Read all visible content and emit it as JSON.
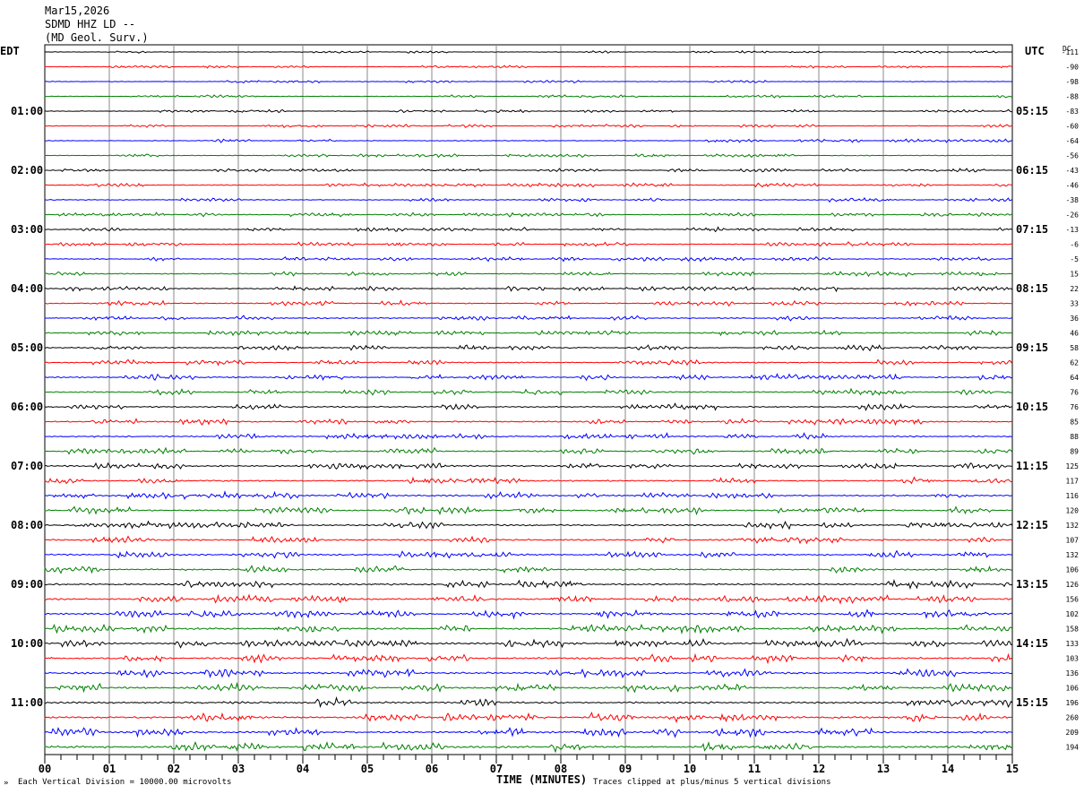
{
  "header": {
    "date": "Mar15,2026",
    "station": "SDMD HHZ LD --",
    "network": "(MD Geol. Surv.)"
  },
  "left_timezone": "EDT",
  "right_timezone": "UTC",
  "dc_label": "DC",
  "footer": {
    "scale": "Each Vertical Division = 10000.00 microvolts",
    "xlabel": "TIME (MINUTES)",
    "clip_note": "Traces clipped at plus/minus 5 vertical divisions"
  },
  "chart_data": {
    "type": "line",
    "title": "",
    "xlabel": "TIME (MINUTES)",
    "xlim": [
      0,
      15
    ],
    "x_tick_labels": [
      "00",
      "01",
      "02",
      "03",
      "04",
      "05",
      "06",
      "07",
      "08",
      "09",
      "10",
      "11",
      "12",
      "13",
      "14",
      "15"
    ],
    "rows_per_hour": 4,
    "trace_colors": [
      "#000000",
      "#ff0000",
      "#0000ff",
      "#008000"
    ],
    "left_hour_labels": [
      "01:00",
      "02:00",
      "03:00",
      "04:00",
      "05:00",
      "06:00",
      "07:00",
      "08:00",
      "09:00",
      "10:00",
      "11:00"
    ],
    "right_hour_labels": [
      "05:15",
      "06:15",
      "07:15",
      "08:15",
      "09:15",
      "10:15",
      "11:15",
      "12:15",
      "13:15",
      "14:15",
      "15:15"
    ],
    "dc_offsets": [
      -111,
      -90,
      -98,
      -88,
      -83,
      -60,
      -64,
      -56,
      -43,
      -46,
      -38,
      -26,
      -13,
      -6,
      -5,
      15,
      22,
      33,
      36,
      46,
      58,
      62,
      64,
      76,
      76,
      85,
      88,
      89,
      125,
      117,
      116,
      120,
      132,
      107,
      132,
      106,
      126,
      156,
      102,
      158,
      133,
      103,
      136,
      106,
      196,
      260,
      209,
      194
    ],
    "grid": true
  }
}
